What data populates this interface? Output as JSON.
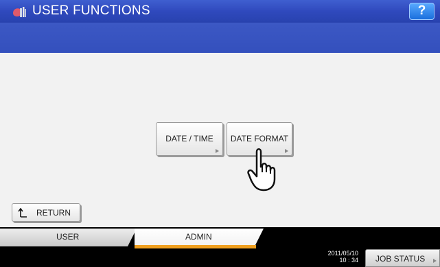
{
  "header": {
    "title": "USER FUNCTIONS",
    "help_label": "?",
    "app_icon": "toolbox-icon"
  },
  "main": {
    "buttons": [
      {
        "label": "DATE / TIME"
      },
      {
        "label": "DATE FORMAT"
      }
    ],
    "pointer_icon": "hand-pointer-icon"
  },
  "footer": {
    "return_label": "RETURN",
    "return_icon": "return-arrow-icon",
    "tabs": [
      {
        "label": "USER",
        "active": false
      },
      {
        "label": "ADMIN",
        "active": true
      }
    ],
    "date": "2011/05/10",
    "time": "10 : 34",
    "job_status_label": "JOB STATUS"
  },
  "colors": {
    "title_bar": "#2f49bd",
    "help_button": "#1a6fdd",
    "active_tab_accent": "#f0a020",
    "background": "#f2f2f2"
  }
}
